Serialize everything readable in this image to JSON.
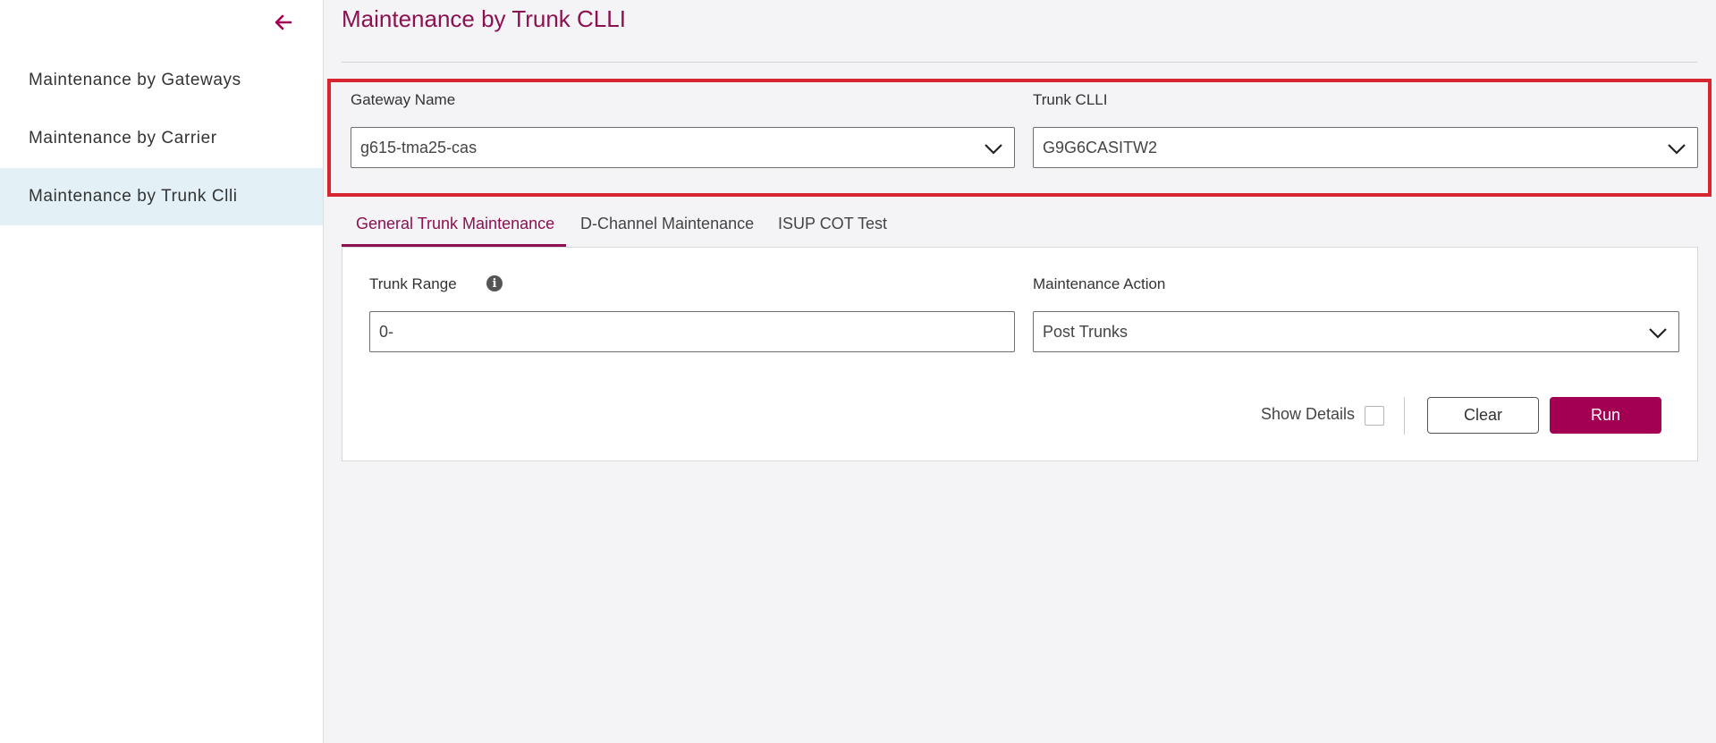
{
  "sidebar": {
    "items": [
      {
        "label": "Maintenance by Gateways"
      },
      {
        "label": "Maintenance by Carrier"
      },
      {
        "label": "Maintenance by Trunk Clli",
        "active": true
      }
    ],
    "collapse_icon": "arrow-left-icon"
  },
  "main": {
    "title": "Maintenance by Trunk CLLI",
    "gateway": {
      "label": "Gateway Name",
      "value": "g615-tma25-cas"
    },
    "trunk_clli": {
      "label": "Trunk CLLI",
      "value": "G9G6CASITW2"
    },
    "tabs": [
      {
        "label": "General Trunk Maintenance",
        "active": true
      },
      {
        "label": "D-Channel Maintenance"
      },
      {
        "label": "ISUP COT Test"
      }
    ],
    "trunk_range": {
      "label": "Trunk Range",
      "value": "0-",
      "info_icon": "info-icon"
    },
    "maintenance_action": {
      "label": "Maintenance Action",
      "value": "Post Trunks"
    },
    "show_details": {
      "label": "Show Details",
      "checked": false
    },
    "buttons": {
      "clear": "Clear",
      "run": "Run"
    }
  },
  "colors": {
    "brand": "#8c1150",
    "run_button": "#a30054",
    "active_nav_bg": "#e3f1f7",
    "highlight_border": "#d7262f",
    "page_bg": "#f4f3f6"
  }
}
